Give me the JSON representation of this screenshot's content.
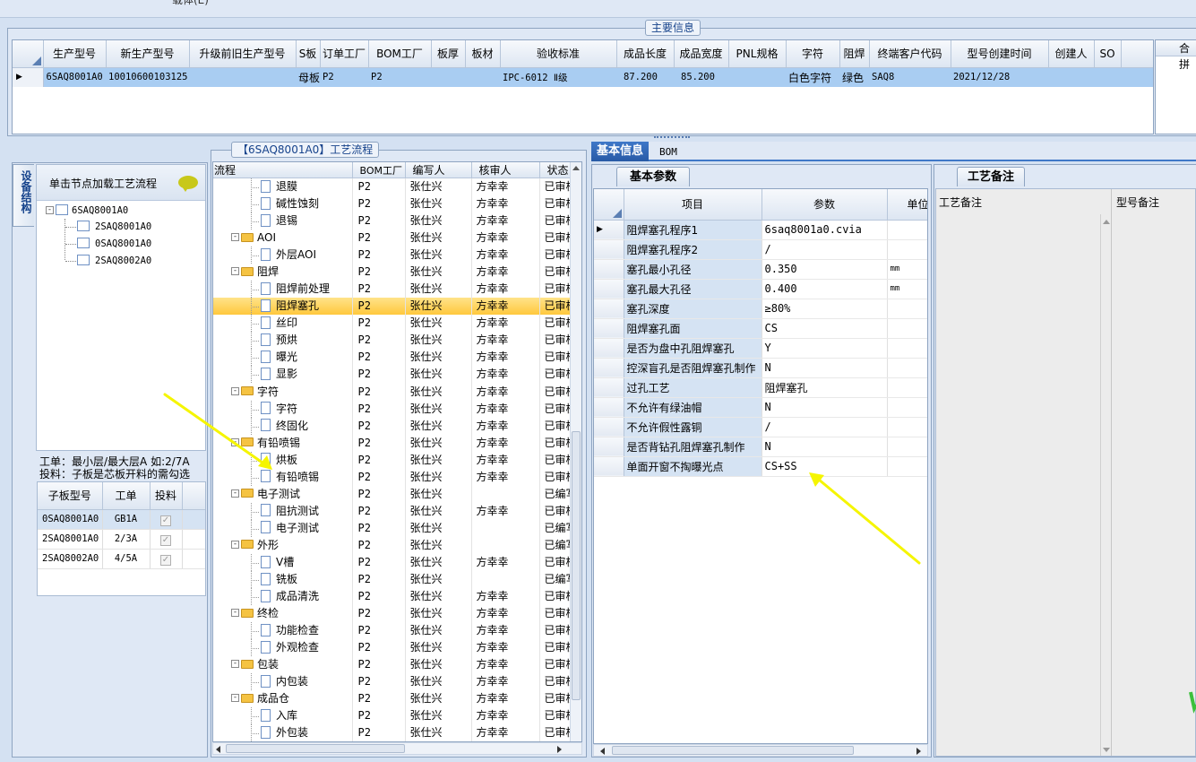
{
  "top_cut_text": "载体(E)",
  "main_info": {
    "title": "主要信息",
    "columns": [
      "生产型号",
      "新生产型号",
      "升级前旧生产型号",
      "S板",
      "订单工厂",
      "BOM工厂",
      "板厚",
      "板材",
      "验收标准",
      "成品长度",
      "成品宽度",
      "PNL规格",
      "字符",
      "阻焊",
      "终端客户代码",
      "型号创建时间",
      "创建人",
      "SO"
    ],
    "row": [
      "6SAQ8001A0",
      "10010600103125",
      "",
      "母板",
      "P2",
      "P2",
      "",
      "",
      "IPC-6012 Ⅱ级",
      "87.200",
      "85.200",
      "",
      "白色字符",
      "绿色",
      "SAQ8",
      "2021/12/28",
      "",
      ""
    ],
    "right_header": "合拼"
  },
  "left_panel": {
    "vtab": "设备结构",
    "hint": "单击节点加载工艺流程",
    "tree_root": "6SAQ8001A0",
    "tree_children": [
      "2SAQ8001A0",
      "0SAQ8001A0",
      "2SAQ8002A0"
    ],
    "note1": "工单：最小层/最大层A 如:2/7A",
    "note2": "投料：子板是芯板开料的需勾选",
    "sub_columns": [
      "子板型号",
      "工单",
      "投料"
    ],
    "sub_rows": [
      {
        "model": "0SAQ8001A0",
        "order": "GB1A",
        "checked": true
      },
      {
        "model": "2SAQ8001A0",
        "order": "2/3A",
        "checked": true
      },
      {
        "model": "2SAQ8002A0",
        "order": "4/5A",
        "checked": true
      }
    ]
  },
  "flow": {
    "title": "【6SAQ8001A0】工艺流程",
    "columns": [
      "流程",
      "BOM工厂",
      "编写人",
      "核审人",
      "状态"
    ],
    "rows": [
      {
        "name": "退膜",
        "type": "doc",
        "factory": "P2",
        "writer": "张仕兴",
        "reviewer": "方幸幸",
        "status": "已审核"
      },
      {
        "name": "碱性蚀刻",
        "type": "doc",
        "factory": "P2",
        "writer": "张仕兴",
        "reviewer": "方幸幸",
        "status": "已审核"
      },
      {
        "name": "退锡",
        "type": "doc",
        "factory": "P2",
        "writer": "张仕兴",
        "reviewer": "方幸幸",
        "status": "已审核"
      },
      {
        "name": "AOI",
        "type": "folder",
        "factory": "P2",
        "writer": "张仕兴",
        "reviewer": "方幸幸",
        "status": "已审核"
      },
      {
        "name": "外层AOI",
        "type": "doc",
        "factory": "P2",
        "writer": "张仕兴",
        "reviewer": "方幸幸",
        "status": "已审核"
      },
      {
        "name": "阻焊",
        "type": "folder",
        "factory": "P2",
        "writer": "张仕兴",
        "reviewer": "方幸幸",
        "status": "已审核"
      },
      {
        "name": "阻焊前处理",
        "type": "doc",
        "factory": "P2",
        "writer": "张仕兴",
        "reviewer": "方幸幸",
        "status": "已审核"
      },
      {
        "name": "阻焊塞孔",
        "type": "doc",
        "factory": "P2",
        "writer": "张仕兴",
        "reviewer": "方幸幸",
        "status": "已审核",
        "selected": true
      },
      {
        "name": "丝印",
        "type": "doc",
        "factory": "P2",
        "writer": "张仕兴",
        "reviewer": "方幸幸",
        "status": "已审核"
      },
      {
        "name": "预烘",
        "type": "doc",
        "factory": "P2",
        "writer": "张仕兴",
        "reviewer": "方幸幸",
        "status": "已审核"
      },
      {
        "name": "曝光",
        "type": "doc",
        "factory": "P2",
        "writer": "张仕兴",
        "reviewer": "方幸幸",
        "status": "已审核"
      },
      {
        "name": "显影",
        "type": "doc",
        "factory": "P2",
        "writer": "张仕兴",
        "reviewer": "方幸幸",
        "status": "已审核"
      },
      {
        "name": "字符",
        "type": "folder",
        "factory": "P2",
        "writer": "张仕兴",
        "reviewer": "方幸幸",
        "status": "已审核"
      },
      {
        "name": "字符",
        "type": "doc",
        "factory": "P2",
        "writer": "张仕兴",
        "reviewer": "方幸幸",
        "status": "已审核"
      },
      {
        "name": "终固化",
        "type": "doc",
        "factory": "P2",
        "writer": "张仕兴",
        "reviewer": "方幸幸",
        "status": "已审核"
      },
      {
        "name": "有铅喷锡",
        "type": "folder",
        "factory": "P2",
        "writer": "张仕兴",
        "reviewer": "方幸幸",
        "status": "已审核"
      },
      {
        "name": "烘板",
        "type": "doc",
        "factory": "P2",
        "writer": "张仕兴",
        "reviewer": "方幸幸",
        "status": "已审核"
      },
      {
        "name": "有铅喷锡",
        "type": "doc",
        "factory": "P2",
        "writer": "张仕兴",
        "reviewer": "方幸幸",
        "status": "已审核"
      },
      {
        "name": "电子测试",
        "type": "folder",
        "factory": "P2",
        "writer": "张仕兴",
        "reviewer": "",
        "status": "已编写"
      },
      {
        "name": "阻抗测试",
        "type": "doc",
        "factory": "P2",
        "writer": "张仕兴",
        "reviewer": "方幸幸",
        "status": "已审核"
      },
      {
        "name": "电子测试",
        "type": "doc",
        "factory": "P2",
        "writer": "张仕兴",
        "reviewer": "",
        "status": "已编写"
      },
      {
        "name": "外形",
        "type": "folder",
        "factory": "P2",
        "writer": "张仕兴",
        "reviewer": "",
        "status": "已编写"
      },
      {
        "name": "V槽",
        "type": "doc",
        "factory": "P2",
        "writer": "张仕兴",
        "reviewer": "方幸幸",
        "status": "已审核"
      },
      {
        "name": "铣板",
        "type": "doc",
        "factory": "P2",
        "writer": "张仕兴",
        "reviewer": "",
        "status": "已编写"
      },
      {
        "name": "成品清洗",
        "type": "doc",
        "factory": "P2",
        "writer": "张仕兴",
        "reviewer": "方幸幸",
        "status": "已审核"
      },
      {
        "name": "终检",
        "type": "folder",
        "factory": "P2",
        "writer": "张仕兴",
        "reviewer": "方幸幸",
        "status": "已审核"
      },
      {
        "name": "功能检查",
        "type": "doc",
        "factory": "P2",
        "writer": "张仕兴",
        "reviewer": "方幸幸",
        "status": "已审核"
      },
      {
        "name": "外观检查",
        "type": "doc",
        "factory": "P2",
        "writer": "张仕兴",
        "reviewer": "方幸幸",
        "status": "已审核"
      },
      {
        "name": "包装",
        "type": "folder",
        "factory": "P2",
        "writer": "张仕兴",
        "reviewer": "方幸幸",
        "status": "已审核"
      },
      {
        "name": "内包装",
        "type": "doc",
        "factory": "P2",
        "writer": "张仕兴",
        "reviewer": "方幸幸",
        "status": "已审核"
      },
      {
        "name": "成品仓",
        "type": "folder",
        "factory": "P2",
        "writer": "张仕兴",
        "reviewer": "方幸幸",
        "status": "已审核"
      },
      {
        "name": "入库",
        "type": "doc",
        "factory": "P2",
        "writer": "张仕兴",
        "reviewer": "方幸幸",
        "status": "已审核"
      },
      {
        "name": "外包装",
        "type": "doc",
        "factory": "P2",
        "writer": "张仕兴",
        "reviewer": "方幸幸",
        "status": "已审核"
      }
    ]
  },
  "right_tabs": [
    "基本信息",
    "BOM"
  ],
  "basic_params": {
    "tab": "基本参数",
    "columns": [
      "项目",
      "参数",
      "单位"
    ],
    "rows": [
      {
        "item": "阻焊塞孔程序1",
        "value": "6saq8001a0.cvia",
        "unit": ""
      },
      {
        "item": "阻焊塞孔程序2",
        "value": "/",
        "unit": ""
      },
      {
        "item": "塞孔最小孔径",
        "value": "0.350",
        "unit": "mm"
      },
      {
        "item": "塞孔最大孔径",
        "value": "0.400",
        "unit": "mm"
      },
      {
        "item": "塞孔深度",
        "value": "≥80%",
        "unit": ""
      },
      {
        "item": "阻焊塞孔面",
        "value": "CS",
        "unit": ""
      },
      {
        "item": "是否为盘中孔阻焊塞孔",
        "value": "Y",
        "unit": ""
      },
      {
        "item": "控深盲孔是否阻焊塞孔制作",
        "value": "N",
        "unit": ""
      },
      {
        "item": "过孔工艺",
        "value": "阻焊塞孔",
        "unit": ""
      },
      {
        "item": "不允许有绿油帽",
        "value": "N",
        "unit": ""
      },
      {
        "item": "不允许假性露铜",
        "value": "/",
        "unit": ""
      },
      {
        "item": "是否背钻孔阻焊塞孔制作",
        "value": "N",
        "unit": ""
      },
      {
        "item": "单面开窗不掏曝光点",
        "value": "CS+SS",
        "unit": ""
      }
    ]
  },
  "remarks": {
    "tab": "工艺备注",
    "col1": "工艺备注",
    "col2": "型号备注"
  }
}
